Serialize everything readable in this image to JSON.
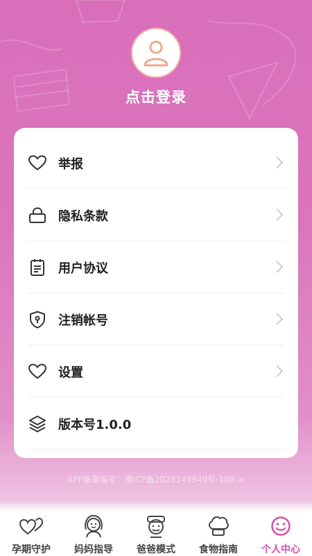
{
  "header": {
    "login_text": "点击登录"
  },
  "menu": [
    {
      "label": "举报",
      "icon": "heart-icon"
    },
    {
      "label": "隐私条款",
      "icon": "lock-icon"
    },
    {
      "label": "用户协议",
      "icon": "document-icon"
    },
    {
      "label": "注销帐号",
      "icon": "shield-icon"
    },
    {
      "label": "设置",
      "icon": "heart-icon"
    },
    {
      "label": "版本号1.0.0",
      "icon": "layers-icon"
    }
  ],
  "footer": {
    "icp": "APP备案编号：豫ICP备2025149940号-10A >"
  },
  "tabs": [
    {
      "label": "孕期守护",
      "icon": "hearts-icon"
    },
    {
      "label": "妈妈指导",
      "icon": "mother-icon"
    },
    {
      "label": "爸爸模式",
      "icon": "father-icon"
    },
    {
      "label": "食物指南",
      "icon": "chef-hat-icon"
    },
    {
      "label": "个人中心",
      "icon": "smiley-icon",
      "active": true
    }
  ],
  "colors": {
    "accent": "#d84bb0",
    "background": "#d96fbb",
    "avatar_figure": "#f0a88f"
  }
}
